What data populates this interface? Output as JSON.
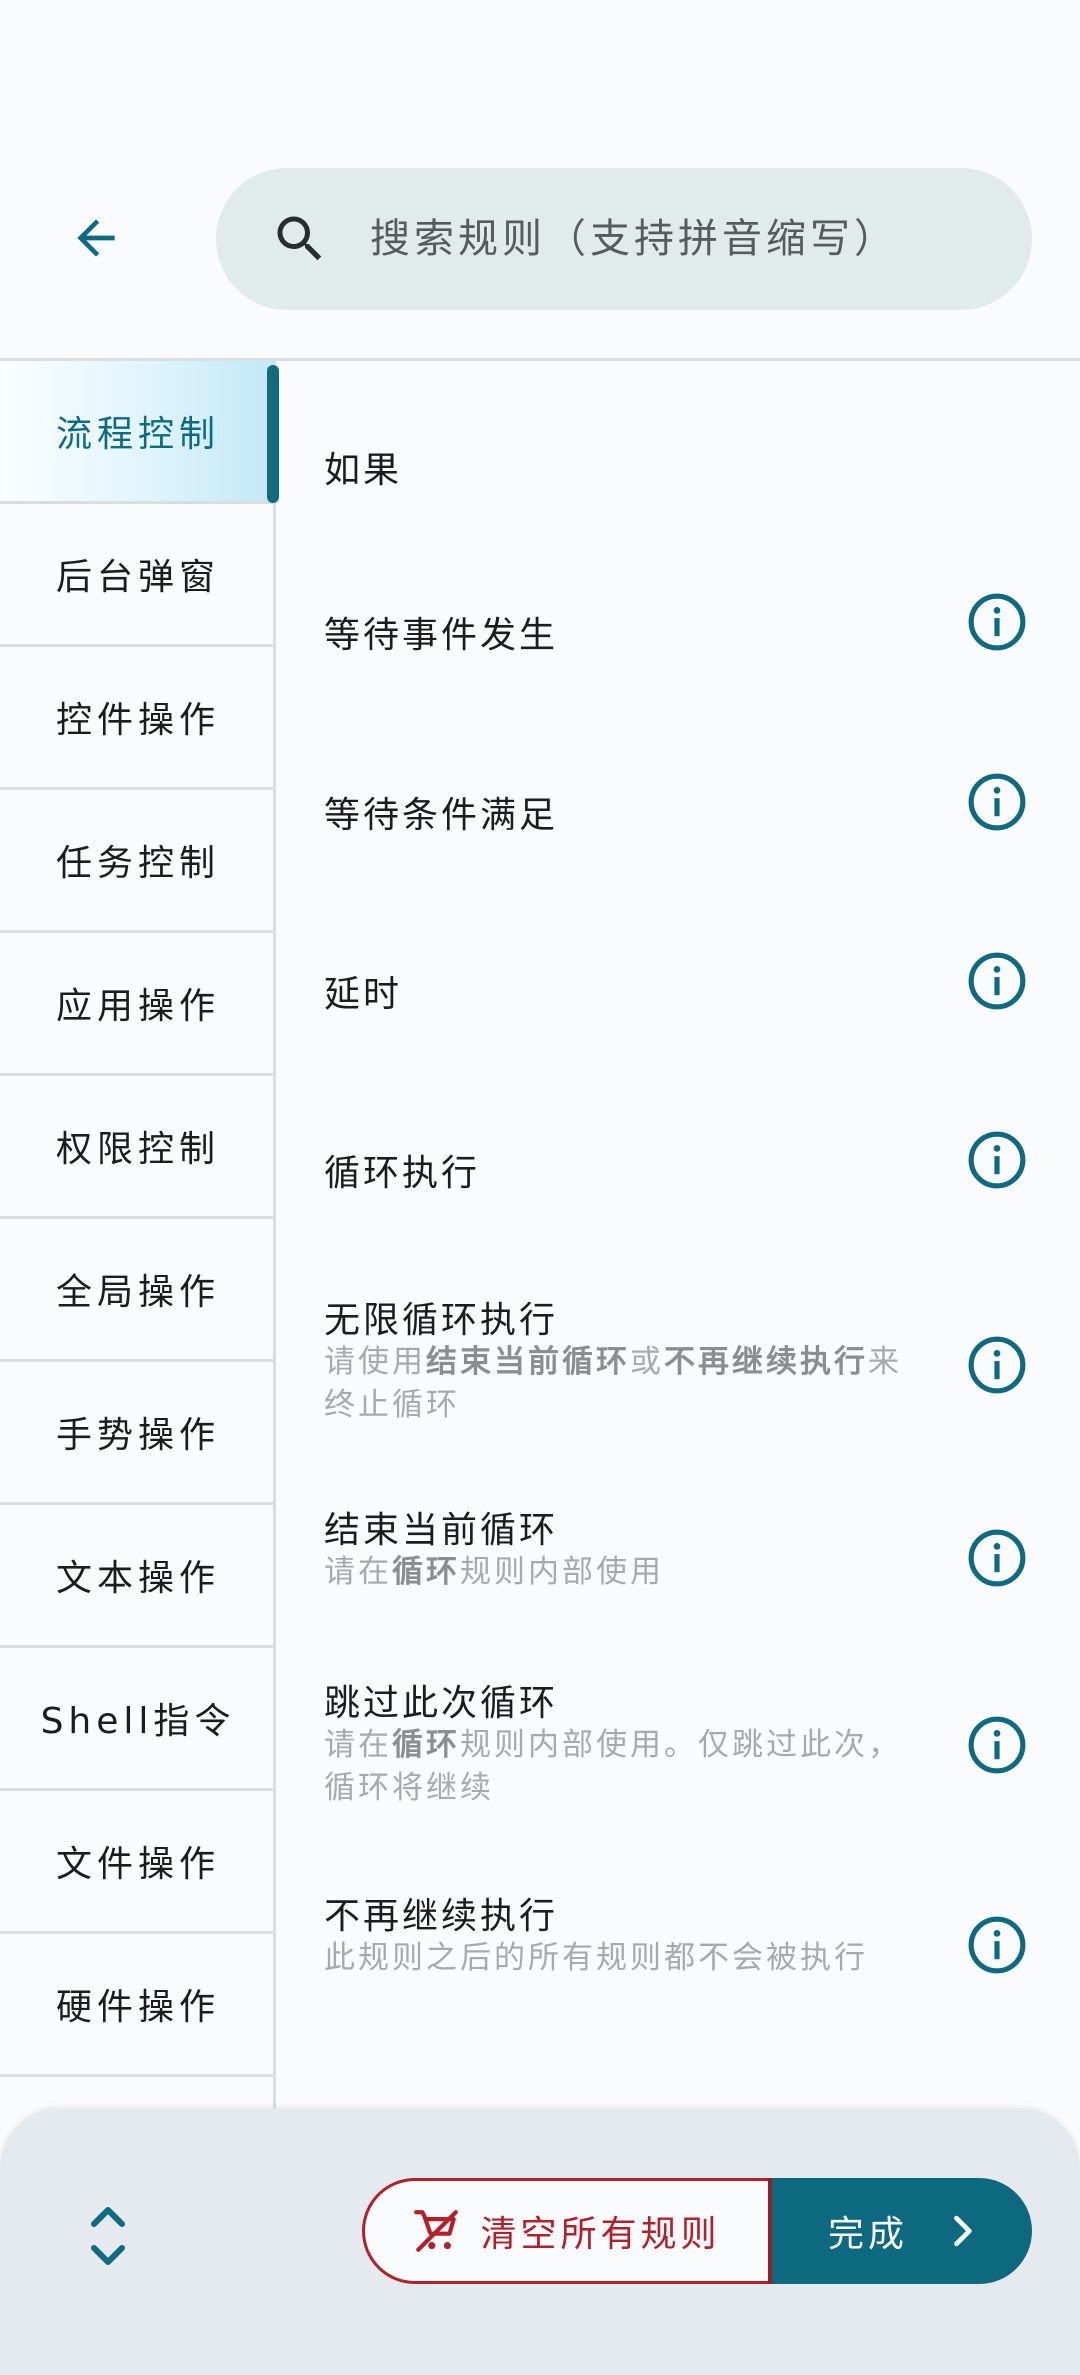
{
  "header": {
    "search_placeholder": "搜索规则（支持拼音缩写）"
  },
  "sidebar": {
    "items": [
      {
        "label": "流程控制",
        "active": true
      },
      {
        "label": "后台弹窗"
      },
      {
        "label": "控件操作"
      },
      {
        "label": "任务控制"
      },
      {
        "label": "应用操作"
      },
      {
        "label": "权限控制"
      },
      {
        "label": "全局操作"
      },
      {
        "label": "手势操作"
      },
      {
        "label": "文本操作"
      },
      {
        "label": "Shell指令"
      },
      {
        "label": "文件操作"
      },
      {
        "label": "硬件操作"
      }
    ]
  },
  "rules": [
    {
      "title": "如果"
    },
    {
      "title": "等待事件发生"
    },
    {
      "title": "等待条件满足"
    },
    {
      "title": "延时"
    },
    {
      "title": "循环执行"
    },
    {
      "title": "无限循环执行",
      "desc": {
        "pre": "请使用",
        "b1": "结束当前循环",
        "mid": "或",
        "b2": "不再继续执行",
        "post": "来终止循环"
      }
    },
    {
      "title": "结束当前循环",
      "desc": {
        "pre": "请在",
        "b1": "循环",
        "post": "规则内部使用"
      }
    },
    {
      "title": "跳过此次循环",
      "desc": {
        "pre": "请在",
        "b1": "循环",
        "post": "规则内部使用。仅跳过此次，循环将继续"
      }
    },
    {
      "title": "不再继续执行",
      "desc": {
        "text": "此规则之后的所有规则都不会被执行"
      }
    }
  ],
  "footer": {
    "clear_label": "清空所有规则",
    "done_label": "完成"
  },
  "colors": {
    "accent": "#0d6980",
    "danger": "#b1202b",
    "search_bg": "#e2ebeb",
    "active_gradient_end": "#c2e8f7"
  },
  "icons": {
    "back": "arrow-left-icon",
    "search": "search-icon",
    "info": "info-circle-icon",
    "expand": "unfold-icon",
    "clear": "cart-remove-icon",
    "next": "chevron-right-icon"
  }
}
